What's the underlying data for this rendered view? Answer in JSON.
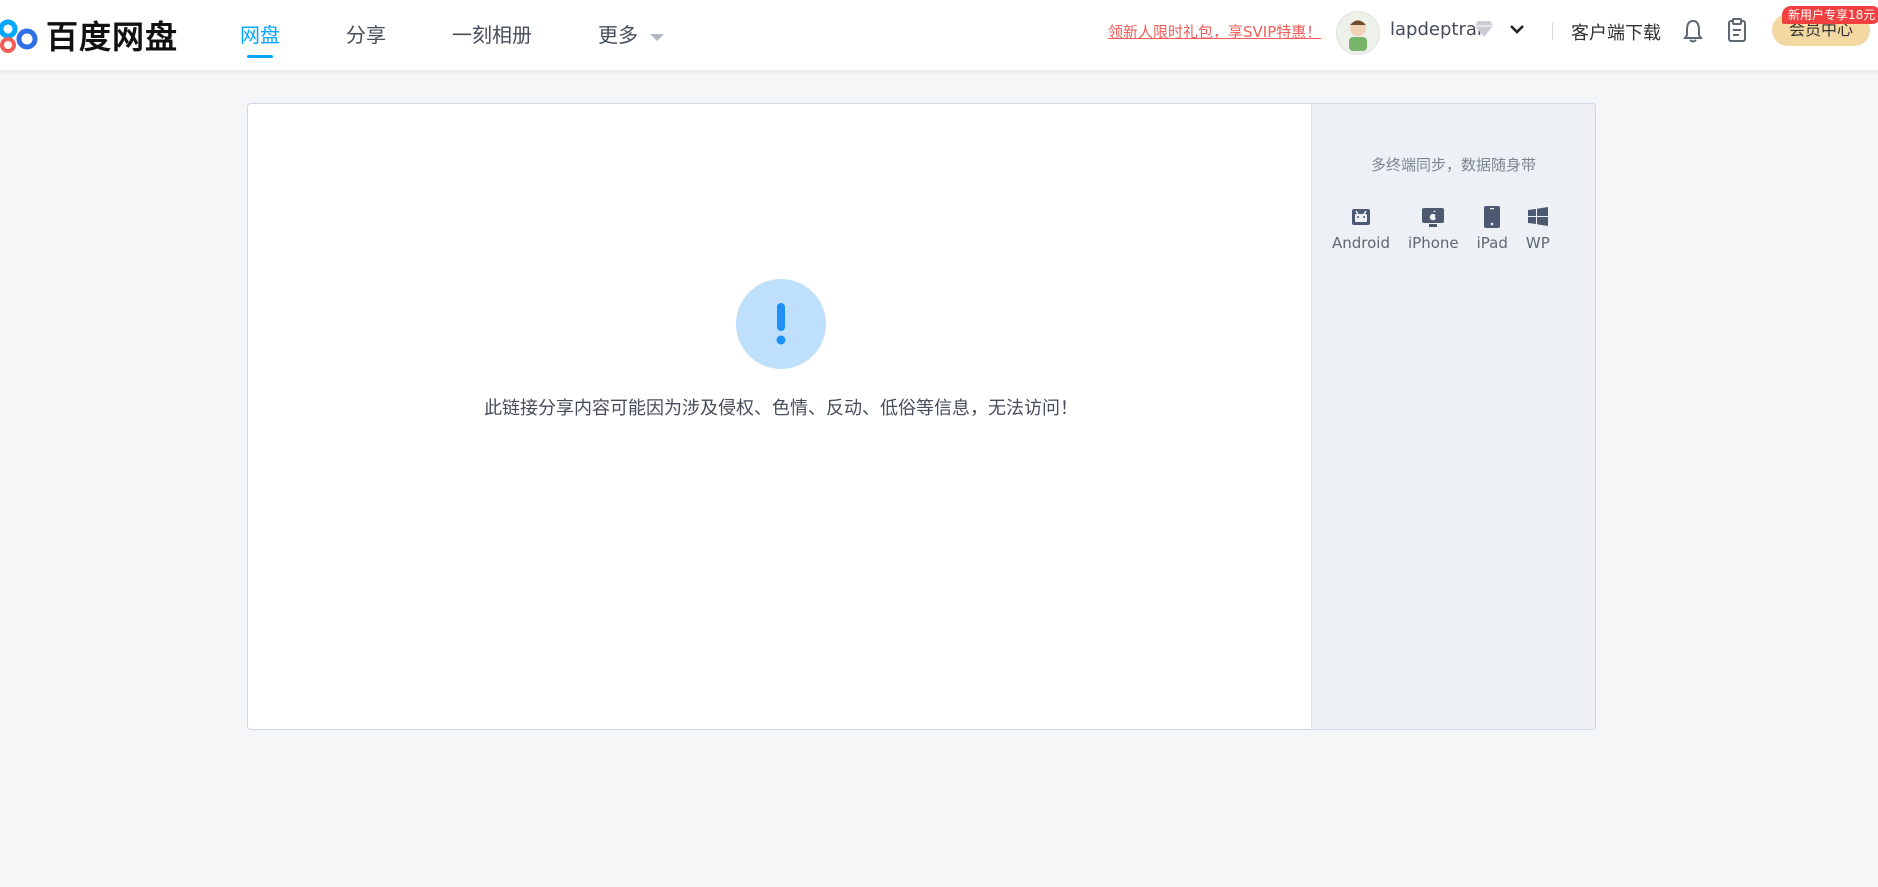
{
  "brand": {
    "logo_text": "百度网盘"
  },
  "nav": [
    {
      "label": "网盘",
      "active": true
    },
    {
      "label": "分享",
      "active": false
    },
    {
      "label": "一刻相册",
      "active": false
    },
    {
      "label": "更多",
      "active": false,
      "has_caret": true
    }
  ],
  "header": {
    "promo": "领新人限时礼包，享SVIP特惠！",
    "username": "lapdeptrai",
    "download": "客户端下载",
    "member_button": "会员中心",
    "member_badge": "新用户专享18元"
  },
  "message": {
    "text": "此链接分享内容可能因为涉及侵权、色情、反动、低俗等信息，无法访问！",
    "icon": "exclamation-icon"
  },
  "side": {
    "title": "多终端同步，数据随身带",
    "platforms": [
      {
        "label": "Android",
        "icon": "android-icon"
      },
      {
        "label": "iPhone",
        "icon": "apple-icon"
      },
      {
        "label": "iPad",
        "icon": "tablet-icon"
      },
      {
        "label": "WP",
        "icon": "windows-icon"
      }
    ]
  },
  "colors": {
    "accent": "#06a7ff",
    "promo": "#f25d58",
    "alert_circle": "#bfe0fd",
    "member": "#f4d8a1",
    "badge": "#f23f3f"
  }
}
